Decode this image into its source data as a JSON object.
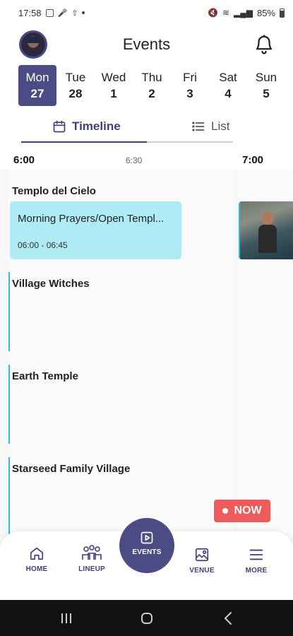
{
  "status_bar": {
    "time": "17:58",
    "battery": "85%"
  },
  "header": {
    "title": "Events"
  },
  "days": [
    {
      "dow": "Mon",
      "dom": "27",
      "selected": true
    },
    {
      "dow": "Tue",
      "dom": "28",
      "selected": false
    },
    {
      "dow": "Wed",
      "dom": "1",
      "selected": false
    },
    {
      "dow": "Thu",
      "dom": "2",
      "selected": false
    },
    {
      "dow": "Fri",
      "dom": "3",
      "selected": false
    },
    {
      "dow": "Sat",
      "dom": "4",
      "selected": false
    },
    {
      "dow": "Sun",
      "dom": "5",
      "selected": false
    }
  ],
  "tabs": {
    "timeline": "Timeline",
    "list": "List",
    "active": "timeline"
  },
  "timeline": {
    "times": [
      "6:00",
      "6:30",
      "7:00"
    ],
    "venues": [
      {
        "name": "Templo del Cielo"
      },
      {
        "name": "Village Witches"
      },
      {
        "name": "Earth Temple"
      },
      {
        "name": "Starseed Family Village"
      }
    ],
    "event": {
      "title": "Morning Prayers/Open Templ...",
      "time": "06:00 - 06:45"
    }
  },
  "now_button": {
    "label": "NOW"
  },
  "bottom_nav": {
    "home": "HOME",
    "lineup": "LINEUP",
    "events": "EVENTS",
    "venue": "VENUE",
    "more": "MORE"
  },
  "colors": {
    "primary": "#4b4b86",
    "accent": "#28bde8",
    "event_card": "#aeebf4",
    "now": "#f05a5a"
  }
}
